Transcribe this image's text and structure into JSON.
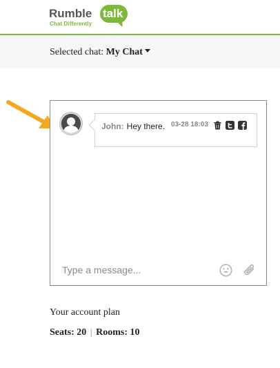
{
  "logo": {
    "word_a": "Rumble",
    "word_b": "talk",
    "tagline": "Chat Differently"
  },
  "selector": {
    "prefix": "Selected chat:",
    "chat_name": "My Chat"
  },
  "message": {
    "author": "John:",
    "text": "Hey there.",
    "time": "03-28 18:03",
    "actions": [
      "trash-icon",
      "twitter-icon",
      "facebook-icon"
    ]
  },
  "composer": {
    "placeholder": "Type a message..."
  },
  "account": {
    "title": "Your account plan",
    "seats_label": "Seats: 20",
    "separator": "|",
    "rooms_label": "Rooms: 10"
  },
  "colors": {
    "brand_green": "#7cb93b",
    "arrow_orange": "#f5a623",
    "bar_bg": "#f5f6f7"
  }
}
